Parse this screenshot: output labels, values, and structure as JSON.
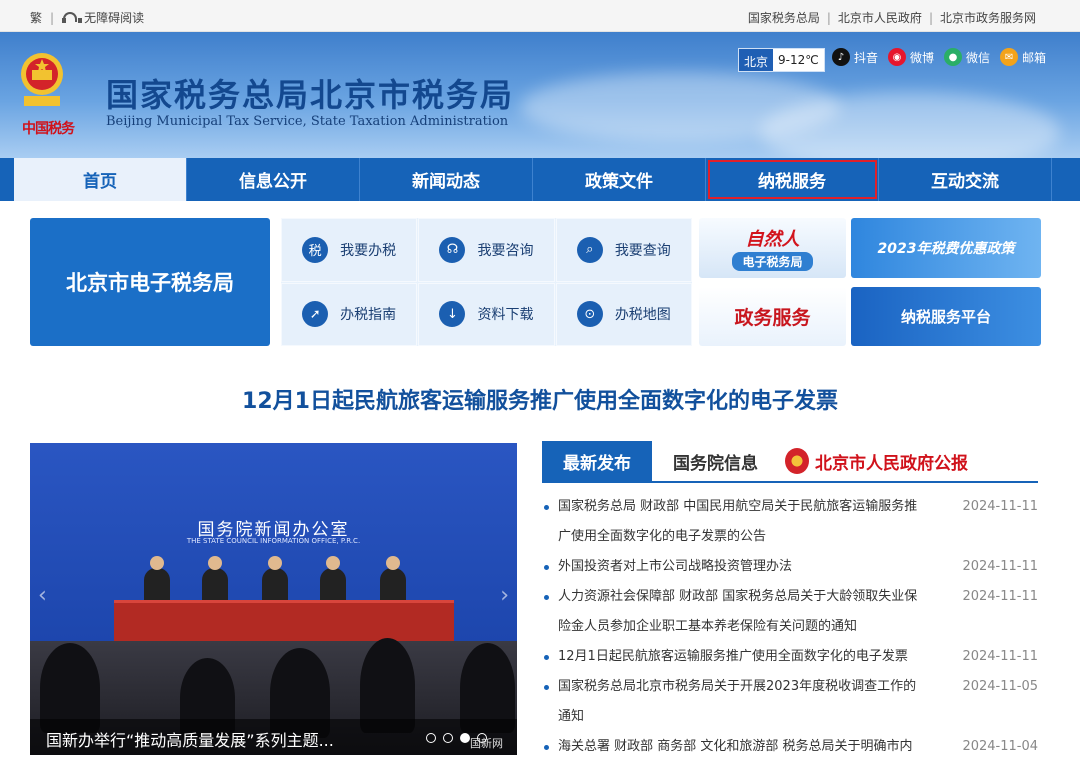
{
  "topbar": {
    "traditional": "繁",
    "accessibility": "无障碍阅读",
    "links": [
      "国家税务总局",
      "北京市人民政府",
      "北京市政务服务网"
    ]
  },
  "header": {
    "title_cn": "国家税务总局北京市税务局",
    "title_en": "Beijing Municipal Tax Service, State Taxation Administration",
    "seal_text": "中国税务",
    "weather_city": "北京",
    "weather_temp": "9-12℃",
    "social": [
      {
        "label": "抖音",
        "icon": "douyin-icon",
        "color": "#111111"
      },
      {
        "label": "微博",
        "icon": "weibo-icon",
        "color": "#e6162d"
      },
      {
        "label": "微信",
        "icon": "wechat-icon",
        "color": "#2aae67"
      },
      {
        "label": "邮箱",
        "icon": "mail-icon",
        "color": "#f3a31b"
      }
    ]
  },
  "nav": {
    "tabs": [
      "首页",
      "信息公开",
      "新闻动态",
      "政策文件",
      "纳税服务",
      "互动交流"
    ],
    "active_index": 0,
    "highlight_index": 4
  },
  "quick": {
    "etax": "北京市电子税务局",
    "cells": [
      {
        "label": "我要办税",
        "icon": "tax-handle-icon"
      },
      {
        "label": "我要咨询",
        "icon": "headset-icon"
      },
      {
        "label": "我要查询",
        "icon": "document-search-icon"
      },
      {
        "label": "办税指南",
        "icon": "compass-icon"
      },
      {
        "label": "资料下载",
        "icon": "download-icon"
      },
      {
        "label": "办税地图",
        "icon": "map-pin-icon"
      }
    ],
    "banners": {
      "natural_person_1": "自然人",
      "natural_person_2": "电子税务局",
      "preferential": "2023年税费优惠政策",
      "gov_service": "政务服务",
      "taxpayer_platform": "纳税服务平台"
    }
  },
  "headline": "12月1日起民航旅客运输服务推广使用全面数字化的电子发票",
  "carousel": {
    "sign": "国务院新闻办公室",
    "sign_en": "THE STATE COUNCIL INFORMATION OFFICE, P.R.C.",
    "caption": "国新办举行“推动高质量发展”系列主题...",
    "watermark": "国新网",
    "slide_count": 4,
    "active_slide": 2
  },
  "news": {
    "tabs": [
      "最新发布",
      "国务院信息"
    ],
    "gov_bulletin": "北京市人民政府公报",
    "items": [
      {
        "lines": [
          "国家税务总局 财政部 中国民用航空局关于民航旅客运输服务推",
          "广使用全面数字化的电子发票的公告"
        ],
        "date": "2024-11-11"
      },
      {
        "lines": [
          "外国投资者对上市公司战略投资管理办法"
        ],
        "date": "2024-11-11"
      },
      {
        "lines": [
          "人力资源社会保障部 财政部 国家税务总局关于大龄领取失业保",
          "险金人员参加企业职工基本养老保险有关问题的通知"
        ],
        "date": "2024-11-11"
      },
      {
        "lines": [
          "12月1日起民航旅客运输服务推广使用全面数字化的电子发票"
        ],
        "date": "2024-11-11"
      },
      {
        "lines": [
          "国家税务总局北京市税务局关于开展2023年度税收调查工作的",
          "通知"
        ],
        "date": "2024-11-05"
      },
      {
        "lines": [
          "海关总署 财政部 商务部 文化和旅游部 税务总局关于明确市内"
        ],
        "date": "2024-11-04"
      }
    ]
  }
}
